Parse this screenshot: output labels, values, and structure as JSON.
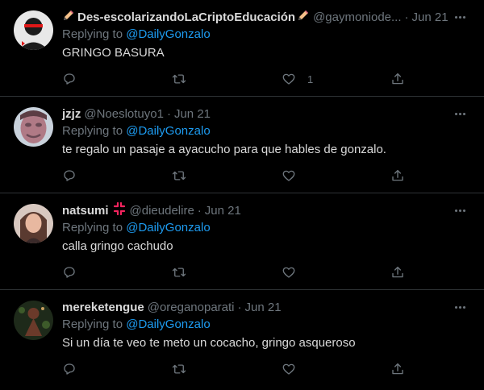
{
  "replying_prefix": "Replying to",
  "tweets": [
    {
      "name": "Des-escolarizandoLaCriptoEducación",
      "handle": "@gaymoniode...",
      "sep": "·",
      "date": "Jun 21",
      "reply_to": "@DailyGonzalo",
      "text": "GRINGO BASURA",
      "likes": "1",
      "avatar_colors": [
        "#f2f2f2",
        "#1c1c1c",
        "#e01818"
      ]
    },
    {
      "name": "jzjz",
      "handle": "@Noeslotuyo1",
      "sep": "·",
      "date": "Jun 21",
      "reply_to": "@DailyGonzalo",
      "text": "te regalo un pasaje a ayacucho para que hables de gonzalo.",
      "likes": "",
      "avatar_colors": [
        "#c9d2dc",
        "#b07a86",
        "#6a4a55"
      ]
    },
    {
      "name": "natsumi",
      "handle": "@dieudelire",
      "sep": "·",
      "date": "Jun 21",
      "reply_to": "@DailyGonzalo",
      "text": "calla gringo cachudo",
      "likes": "",
      "badge": "anger-symbol-icon",
      "avatar_colors": [
        "#d8c8c0",
        "#5a3a30",
        "#e8b8a0"
      ]
    },
    {
      "name": "mereketengue",
      "handle": "@oreganoparati",
      "sep": "·",
      "date": "Jun 21",
      "reply_to": "@DailyGonzalo",
      "text": "Si un día te veo te meto un cocacho, gringo asqueroso",
      "likes": "",
      "avatar_colors": [
        "#1e2a1a",
        "#6b3a2a",
        "#3d5a2a"
      ]
    }
  ],
  "colors": {
    "background": "#000000",
    "text": "#d9d9d9",
    "muted": "#6e767d",
    "link": "#1d9bf0",
    "divider": "#2f3336"
  },
  "icons": [
    "reply-icon",
    "retweet-icon",
    "like-icon",
    "share-icon",
    "more-options-icon",
    "pencil-icon",
    "anger-symbol-icon"
  ]
}
